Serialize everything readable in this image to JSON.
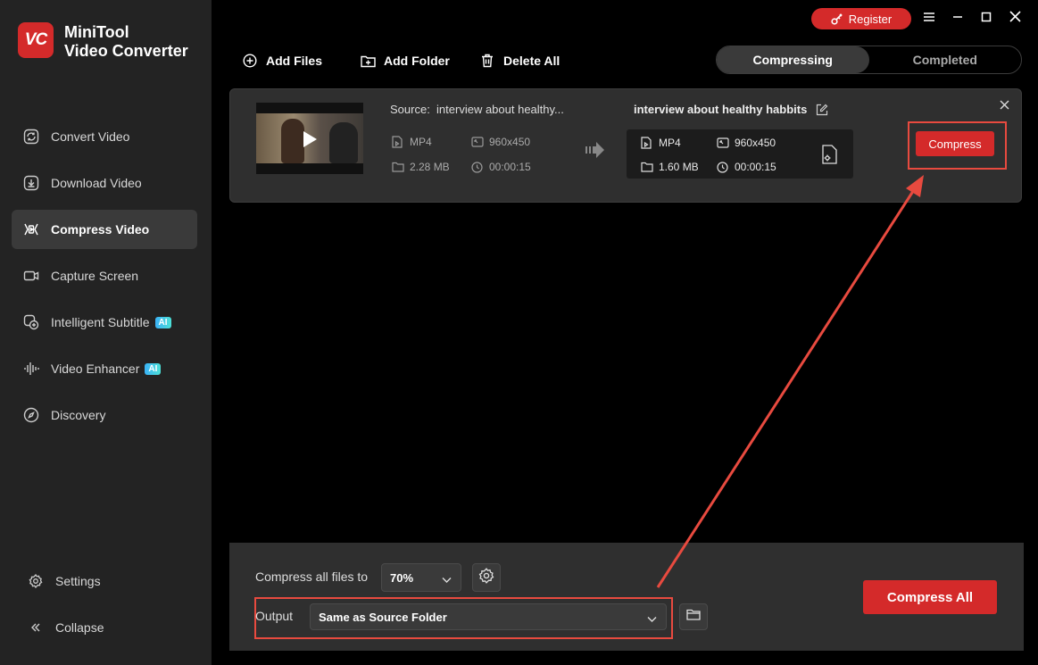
{
  "app": {
    "logo_text": "VC",
    "title_line1": "MiniTool",
    "title_line2": "Video Converter"
  },
  "sidebar": {
    "items": [
      {
        "label": "Convert Video"
      },
      {
        "label": "Download Video"
      },
      {
        "label": "Compress Video"
      },
      {
        "label": "Capture Screen"
      },
      {
        "label": "Intelligent Subtitle",
        "badge": "AI"
      },
      {
        "label": "Video Enhancer",
        "badge": "AI"
      },
      {
        "label": "Discovery"
      }
    ],
    "active_index": 2,
    "settings_label": "Settings",
    "collapse_label": "Collapse"
  },
  "topbar": {
    "register_label": "Register"
  },
  "toolbar": {
    "add_files": "Add Files",
    "add_folder": "Add Folder",
    "delete_all": "Delete All"
  },
  "tabs": {
    "compressing": "Compressing",
    "completed": "Completed",
    "active": "compressing"
  },
  "task": {
    "source_prefix": "Source:",
    "source_name": "interview about healthy...",
    "source_format": "MP4",
    "source_resolution": "960x450",
    "source_size": "2.28 MB",
    "source_duration": "00:00:15",
    "output_name": "interview about healthy habbits",
    "output_format": "MP4",
    "output_resolution": "960x450",
    "output_size": "1.60 MB",
    "output_duration": "00:00:15",
    "compress_label": "Compress"
  },
  "bottom": {
    "compress_all_to_label": "Compress all files to",
    "compress_percent": "70%",
    "output_label": "Output",
    "output_folder": "Same as Source Folder",
    "compress_all_label": "Compress All"
  },
  "colors": {
    "accent": "#d42a2a",
    "highlight": "#e84a3f",
    "sidebar_bg": "#232323",
    "panel_bg": "#2f2f2f"
  }
}
